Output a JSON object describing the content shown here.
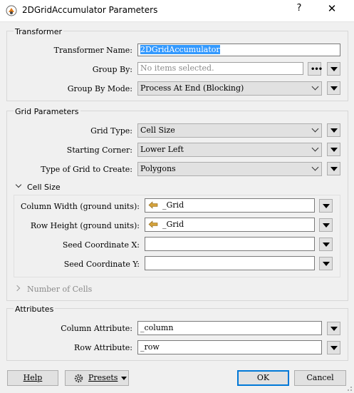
{
  "window": {
    "title": "2DGridAccumulator Parameters",
    "help_glyph": "?",
    "close_glyph": "✕",
    "app_icon": "fme-transformer-icon"
  },
  "transformer": {
    "title": "Transformer",
    "name_label": "Transformer Name:",
    "name_value": "2DGridAccumulator",
    "group_by_label": "Group By:",
    "group_by_placeholder": "No items selected.",
    "group_by_mode_label": "Group By Mode:",
    "group_by_mode_value": "Process At End (Blocking)"
  },
  "grid": {
    "title": "Grid Parameters",
    "grid_type_label": "Grid Type:",
    "grid_type_value": "Cell Size",
    "starting_corner_label": "Starting Corner:",
    "starting_corner_value": "Lower Left",
    "grid_create_label": "Type of Grid to Create:",
    "grid_create_value": "Polygons",
    "cell_size": {
      "title": "Cell Size",
      "expanded": true,
      "column_width_label": "Column Width (ground units):",
      "column_width_value": "_Grid",
      "row_height_label": "Row Height (ground units):",
      "row_height_value": "_Grid",
      "seed_x_label": "Seed Coordinate X:",
      "seed_x_value": "",
      "seed_y_label": "Seed Coordinate Y:",
      "seed_y_value": ""
    },
    "number_of_cells": {
      "title": "Number of Cells",
      "expanded": false
    }
  },
  "attributes": {
    "title": "Attributes",
    "column_label": "Column Attribute:",
    "column_value": "_column",
    "row_label": "Row Attribute:",
    "row_value": "_row"
  },
  "footer": {
    "help": "Help",
    "presets": "Presets",
    "ok": "OK",
    "cancel": "Cancel"
  }
}
